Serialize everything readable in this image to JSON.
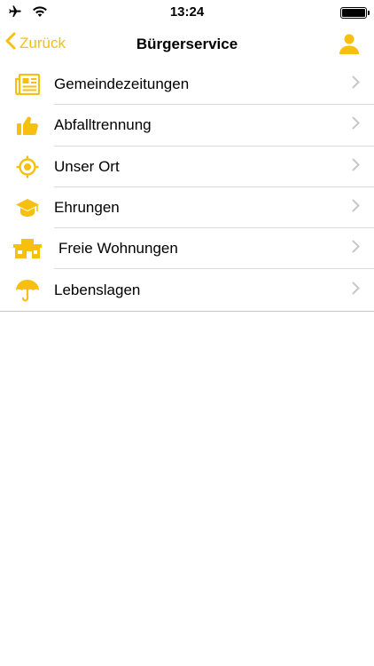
{
  "status_bar": {
    "time": "13:24",
    "icons": [
      "airplane-icon",
      "wifi-icon",
      "battery-icon"
    ]
  },
  "nav": {
    "back_label": "Zurück",
    "title": "Bürgerservice",
    "user_icon": "user-icon"
  },
  "colors": {
    "accent": "#f7bf0f",
    "chevron": "#c7c7cc",
    "separator": "#dcdce0"
  },
  "menu": {
    "items": [
      {
        "label": "Gemeindezeitungen",
        "icon": "newspaper-icon"
      },
      {
        "label": "Abfalltrennung",
        "icon": "thumbs-up-icon"
      },
      {
        "label": "Unser Ort",
        "icon": "location-target-icon"
      },
      {
        "label": "Ehrungen",
        "icon": "graduation-cap-icon"
      },
      {
        "label": "Freie Wohnungen",
        "icon": "building-icon"
      },
      {
        "label": "Lebenslagen",
        "icon": "umbrella-icon"
      }
    ]
  }
}
